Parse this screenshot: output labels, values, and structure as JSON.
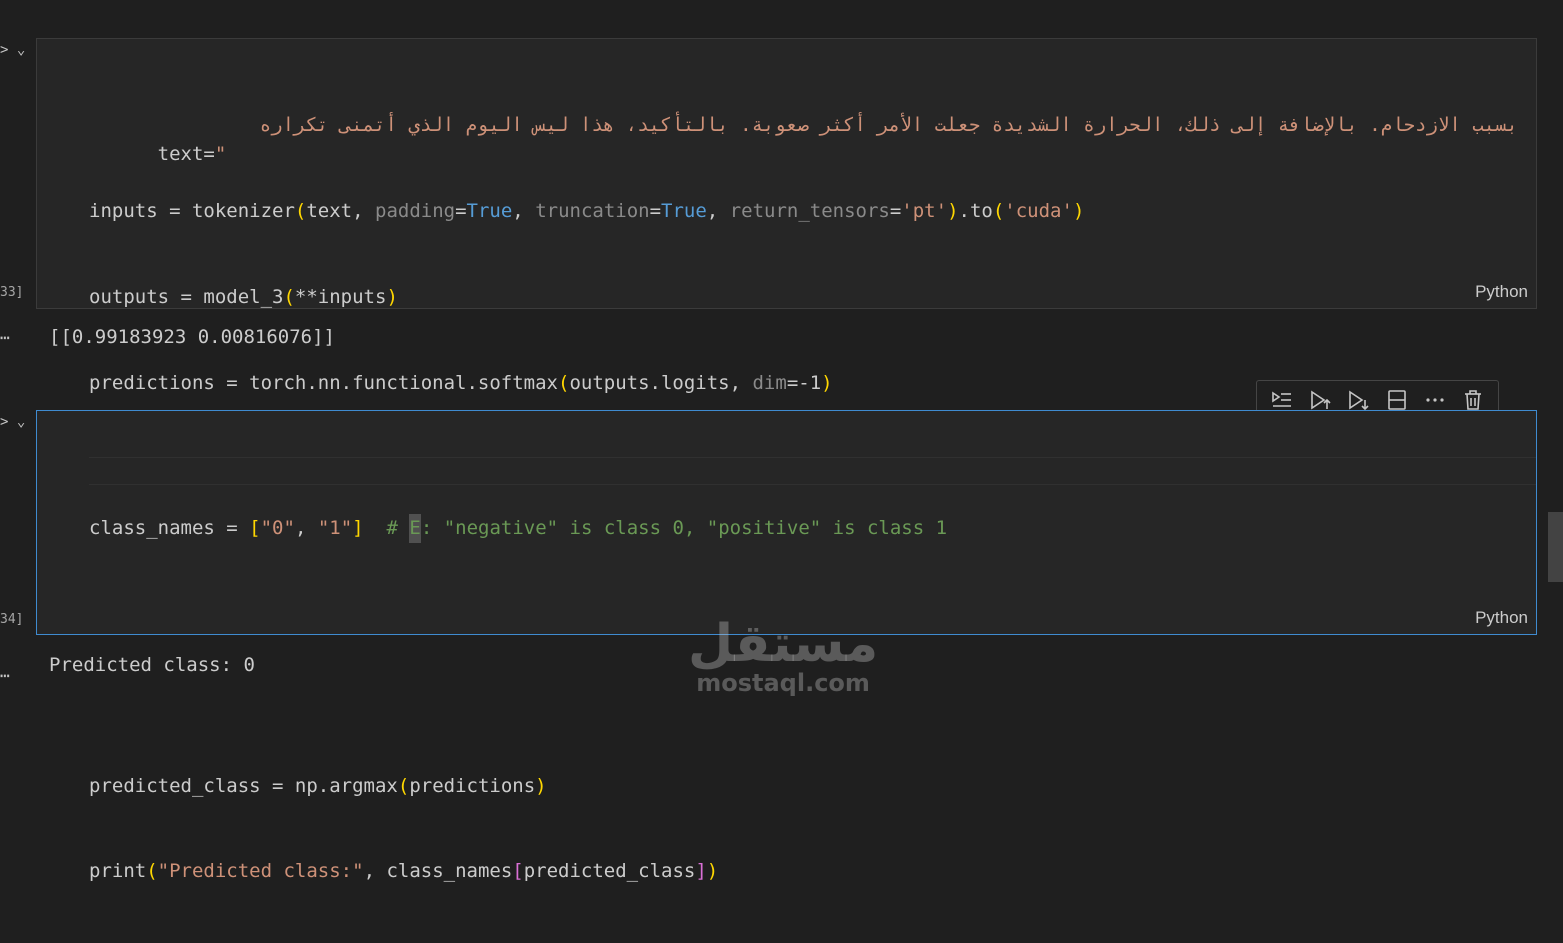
{
  "cells": [
    {
      "execution_count": "33]",
      "language": "Python",
      "arabic_text": "بسبب الازدحام. بالإضافة إلى ذلك، الحرارة الشديدة جعلت الأمر أكثر صعوبة. بالتأكيد، هذا ليس اليوم الذي أتمنى تكراره",
      "output": "[[0.99183923 0.00816076]]"
    },
    {
      "execution_count": "34]",
      "language": "Python",
      "comment_tail": ": \"negative\" is class 0, \"positive\" is class 1",
      "output": "Predicted class: 0"
    }
  ],
  "toolbar": {
    "buttons": [
      "execute-above-icon",
      "run-above-icon",
      "run-below-icon",
      "split-cell-icon",
      "more-actions-icon",
      "delete-cell-icon"
    ]
  },
  "watermark": {
    "arabic": "مستقل",
    "latin": "mostaql.com"
  }
}
